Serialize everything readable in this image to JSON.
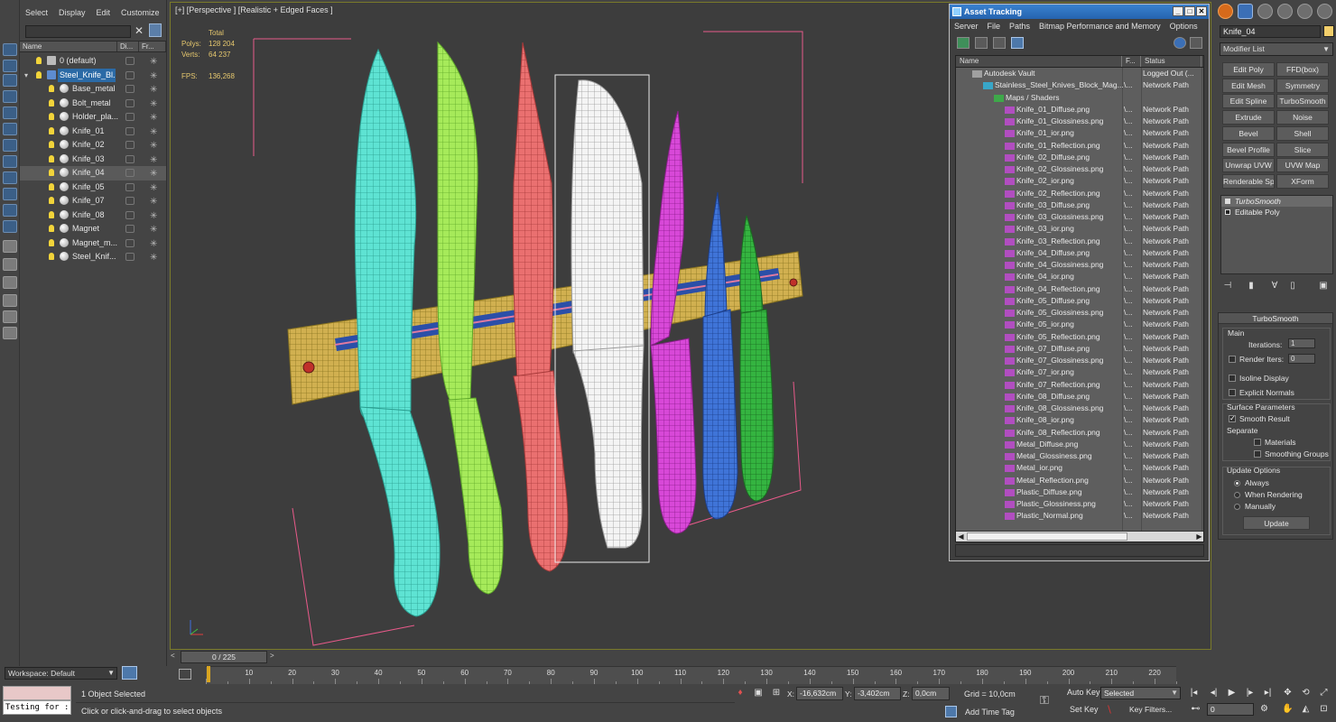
{
  "scene_explorer": {
    "menu": [
      "Select",
      "Display",
      "Edit",
      "Customize"
    ],
    "columns": [
      "Name",
      "Di...",
      "Fr..."
    ],
    "items": [
      {
        "label": "0 (default)",
        "type": "layer"
      },
      {
        "label": "Steel_Knife_Bl...",
        "type": "layer-selected"
      },
      {
        "label": "Base_metal",
        "type": "object"
      },
      {
        "label": "Bolt_metal",
        "type": "object"
      },
      {
        "label": "Holder_pla...",
        "type": "object"
      },
      {
        "label": "Knife_01",
        "type": "object"
      },
      {
        "label": "Knife_02",
        "type": "object"
      },
      {
        "label": "Knife_03",
        "type": "object"
      },
      {
        "label": "Knife_04",
        "type": "object-selected"
      },
      {
        "label": "Knife_05",
        "type": "object"
      },
      {
        "label": "Knife_07",
        "type": "object"
      },
      {
        "label": "Knife_08",
        "type": "object"
      },
      {
        "label": "Magnet",
        "type": "object"
      },
      {
        "label": "Magnet_m...",
        "type": "object"
      },
      {
        "label": "Steel_Knif...",
        "type": "object"
      }
    ],
    "close_glyph": "✕"
  },
  "viewport": {
    "label": "[+] [Perspective ] [Realistic + Edged Faces ]",
    "stats": {
      "total_label": "Total",
      "polys_label": "Polys:",
      "polys_value": "128 204",
      "verts_label": "Verts:",
      "verts_value": "64 237",
      "fps_label": "FPS:",
      "fps_value": "136,268"
    },
    "axis": {
      "x": "x",
      "y": "y",
      "z": "z"
    }
  },
  "asset_tracking": {
    "title": "Asset Tracking",
    "window_buttons": [
      "_",
      "□",
      "✕"
    ],
    "menu": [
      "Server",
      "File",
      "Paths",
      "Bitmap Performance and Memory",
      "Options"
    ],
    "columns": [
      "Name",
      "F...",
      "Status",
      "F"
    ],
    "rows": [
      {
        "name": "Autodesk Vault",
        "f": "",
        "status": "Logged Out (...",
        "indent": 0,
        "icon": "vault"
      },
      {
        "name": "Stainless_Steel_Knives_Block_Mag...",
        "f": "\\...",
        "status": "Network Path",
        "indent": 1,
        "icon": "max"
      },
      {
        "name": "Maps / Shaders",
        "f": "",
        "status": "",
        "indent": 2,
        "icon": "maps"
      },
      {
        "name": "Knife_01_Diffuse.png",
        "f": "\\...",
        "status": "Network Path",
        "indent": 3,
        "icon": "png"
      },
      {
        "name": "Knife_01_Glossiness.png",
        "f": "\\...",
        "status": "Network Path",
        "indent": 3,
        "icon": "png"
      },
      {
        "name": "Knife_01_ior.png",
        "f": "\\...",
        "status": "Network Path",
        "indent": 3,
        "icon": "png"
      },
      {
        "name": "Knife_01_Reflection.png",
        "f": "\\...",
        "status": "Network Path",
        "indent": 3,
        "icon": "png"
      },
      {
        "name": "Knife_02_Diffuse.png",
        "f": "\\...",
        "status": "Network Path",
        "indent": 3,
        "icon": "png"
      },
      {
        "name": "Knife_02_Glossiness.png",
        "f": "\\...",
        "status": "Network Path",
        "indent": 3,
        "icon": "png"
      },
      {
        "name": "Knife_02_ior.png",
        "f": "\\...",
        "status": "Network Path",
        "indent": 3,
        "icon": "png"
      },
      {
        "name": "Knife_02_Reflection.png",
        "f": "\\...",
        "status": "Network Path",
        "indent": 3,
        "icon": "png"
      },
      {
        "name": "Knife_03_Diffuse.png",
        "f": "\\...",
        "status": "Network Path",
        "indent": 3,
        "icon": "png"
      },
      {
        "name": "Knife_03_Glossiness.png",
        "f": "\\...",
        "status": "Network Path",
        "indent": 3,
        "icon": "png"
      },
      {
        "name": "Knife_03_ior.png",
        "f": "\\...",
        "status": "Network Path",
        "indent": 3,
        "icon": "png"
      },
      {
        "name": "Knife_03_Reflection.png",
        "f": "\\...",
        "status": "Network Path",
        "indent": 3,
        "icon": "png"
      },
      {
        "name": "Knife_04_Diffuse.png",
        "f": "\\...",
        "status": "Network Path",
        "indent": 3,
        "icon": "png"
      },
      {
        "name": "Knife_04_Glossiness.png",
        "f": "\\...",
        "status": "Network Path",
        "indent": 3,
        "icon": "png"
      },
      {
        "name": "Knife_04_ior.png",
        "f": "\\...",
        "status": "Network Path",
        "indent": 3,
        "icon": "png"
      },
      {
        "name": "Knife_04_Reflection.png",
        "f": "\\...",
        "status": "Network Path",
        "indent": 3,
        "icon": "png"
      },
      {
        "name": "Knife_05_Diffuse.png",
        "f": "\\...",
        "status": "Network Path",
        "indent": 3,
        "icon": "png"
      },
      {
        "name": "Knife_05_Glossiness.png",
        "f": "\\...",
        "status": "Network Path",
        "indent": 3,
        "icon": "png"
      },
      {
        "name": "Knife_05_ior.png",
        "f": "\\...",
        "status": "Network Path",
        "indent": 3,
        "icon": "png"
      },
      {
        "name": "Knife_05_Reflection.png",
        "f": "\\...",
        "status": "Network Path",
        "indent": 3,
        "icon": "png"
      },
      {
        "name": "Knife_07_Diffuse.png",
        "f": "\\...",
        "status": "Network Path",
        "indent": 3,
        "icon": "png"
      },
      {
        "name": "Knife_07_Glossiness.png",
        "f": "\\...",
        "status": "Network Path",
        "indent": 3,
        "icon": "png"
      },
      {
        "name": "Knife_07_ior.png",
        "f": "\\...",
        "status": "Network Path",
        "indent": 3,
        "icon": "png"
      },
      {
        "name": "Knife_07_Reflection.png",
        "f": "\\...",
        "status": "Network Path",
        "indent": 3,
        "icon": "png"
      },
      {
        "name": "Knife_08_Diffuse.png",
        "f": "\\...",
        "status": "Network Path",
        "indent": 3,
        "icon": "png"
      },
      {
        "name": "Knife_08_Glossiness.png",
        "f": "\\...",
        "status": "Network Path",
        "indent": 3,
        "icon": "png"
      },
      {
        "name": "Knife_08_ior.png",
        "f": "\\...",
        "status": "Network Path",
        "indent": 3,
        "icon": "png"
      },
      {
        "name": "Knife_08_Reflection.png",
        "f": "\\...",
        "status": "Network Path",
        "indent": 3,
        "icon": "png"
      },
      {
        "name": "Metal_Diffuse.png",
        "f": "\\...",
        "status": "Network Path",
        "indent": 3,
        "icon": "png"
      },
      {
        "name": "Metal_Glossiness.png",
        "f": "\\...",
        "status": "Network Path",
        "indent": 3,
        "icon": "png"
      },
      {
        "name": "Metal_ior.png",
        "f": "\\...",
        "status": "Network Path",
        "indent": 3,
        "icon": "png"
      },
      {
        "name": "Metal_Reflection.png",
        "f": "\\...",
        "status": "Network Path",
        "indent": 3,
        "icon": "png"
      },
      {
        "name": "Plastic_Diffuse.png",
        "f": "\\...",
        "status": "Network Path",
        "indent": 3,
        "icon": "png"
      },
      {
        "name": "Plastic_Glossiness.png",
        "f": "\\...",
        "status": "Network Path",
        "indent": 3,
        "icon": "png"
      },
      {
        "name": "Plastic_Normal.png",
        "f": "\\...",
        "status": "Network Path",
        "indent": 3,
        "icon": "png"
      }
    ]
  },
  "command_panel": {
    "object_name": "Knife_04",
    "object_color": "#f3cf6b",
    "modifier_list": "Modifier List",
    "modifier_buttons": [
      "Edit Poly",
      "FFD(box)",
      "Edit Mesh",
      "Symmetry",
      "Edit Spline",
      "TurboSmooth",
      "Extrude",
      "Noise",
      "Bevel",
      "Shell",
      "Bevel Profile",
      "Slice",
      "Unwrap UVW",
      "UVW Map",
      "Renderable Spline",
      "XForm"
    ],
    "stack": [
      "TurboSmooth",
      "Editable Poly"
    ],
    "rollout": {
      "title": "TurboSmooth",
      "main_label": "Main",
      "iterations_label": "Iterations:",
      "iterations_value": "1",
      "render_iters_label": "Render Iters:",
      "render_iters_value": "0",
      "isoline_label": "Isoline Display",
      "explicit_normals_label": "Explicit Normals",
      "surface_params_label": "Surface Parameters",
      "smooth_result_label": "Smooth Result",
      "separate_label": "Separate",
      "materials_label": "Materials",
      "smoothing_groups_label": "Smoothing Groups",
      "update_options_label": "Update Options",
      "always_label": "Always",
      "when_rendering_label": "When Rendering",
      "manually_label": "Manually",
      "update_button": "Update"
    }
  },
  "timeline": {
    "frame_display": "0 / 225",
    "left_arrow": "<",
    "right_arrow": ">",
    "ticks": [
      "10",
      "20",
      "30",
      "40",
      "50",
      "60",
      "70",
      "80",
      "90",
      "100",
      "110",
      "120",
      "130",
      "140",
      "150",
      "160",
      "170",
      "180",
      "190",
      "200",
      "210",
      "220"
    ]
  },
  "workspace": {
    "label": "Workspace: Default"
  },
  "status_bar": {
    "maxscript_text": "Testing for :",
    "selection_text": "1 Object Selected",
    "prompt_text": "Click or click-and-drag to select objects",
    "x_label": "X:",
    "x_value": "-16,632cm",
    "y_label": "Y:",
    "y_value": "-3,402cm",
    "z_label": "Z:",
    "z_value": "0,0cm",
    "grid_text": "Grid = 10,0cm",
    "add_time_tag": "Add Time Tag",
    "auto_key": "Auto Key",
    "set_key": "Set Key",
    "selected_dropdown": "Selected",
    "key_filters": "Key Filters...",
    "frame_value": "0"
  }
}
